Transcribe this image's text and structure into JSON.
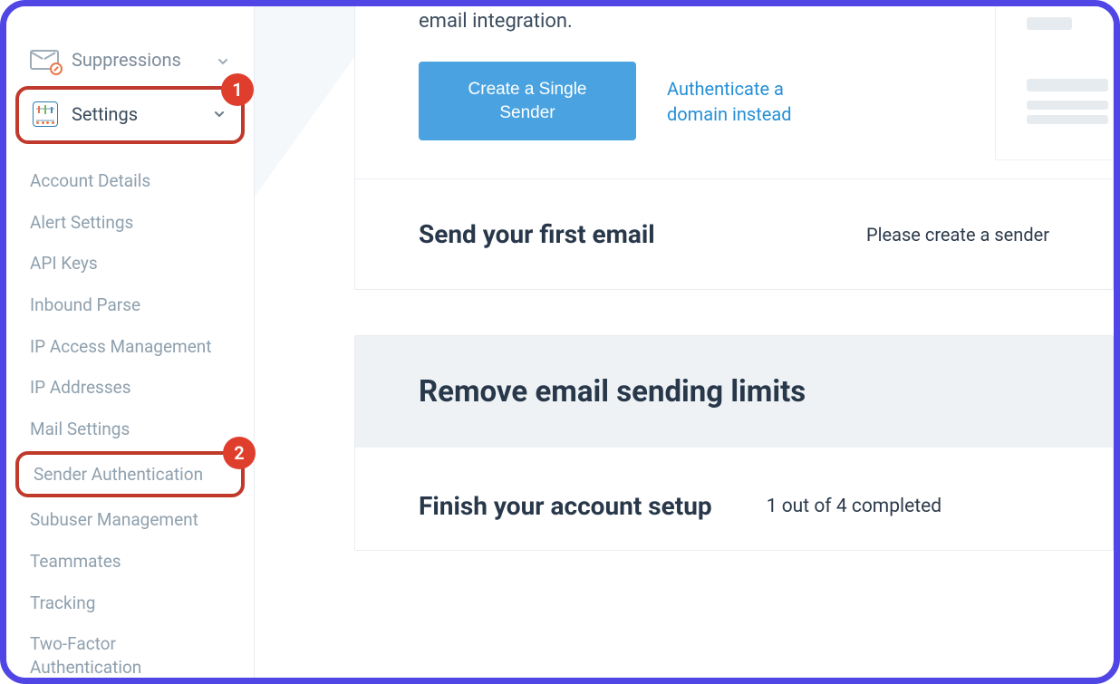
{
  "sidebar": {
    "groups": {
      "suppressions": {
        "label": "Suppressions"
      },
      "settings": {
        "label": "Settings"
      }
    },
    "settings_items": [
      {
        "label": "Account Details"
      },
      {
        "label": "Alert Settings"
      },
      {
        "label": "API Keys"
      },
      {
        "label": "Inbound Parse"
      },
      {
        "label": "IP Access Management"
      },
      {
        "label": "IP Addresses"
      },
      {
        "label": "Mail Settings"
      },
      {
        "label": "Sender Authentication"
      },
      {
        "label": "Subuser Management"
      },
      {
        "label": "Teammates"
      },
      {
        "label": "Tracking"
      },
      {
        "label": "Two-Factor Authentication"
      }
    ]
  },
  "annotations": {
    "badge1": "1",
    "badge2": "2"
  },
  "main": {
    "intro_text": "email integration.",
    "create_sender_button": "Create a Single Sender",
    "auth_domain_link": "Authenticate a domain instead",
    "send_first_email_title": "Send your first email",
    "send_first_email_status": "Please create a sender",
    "remove_limits_title": "Remove email sending limits",
    "finish_setup_title": "Finish your account setup",
    "finish_setup_progress": "1 out of 4 completed"
  }
}
